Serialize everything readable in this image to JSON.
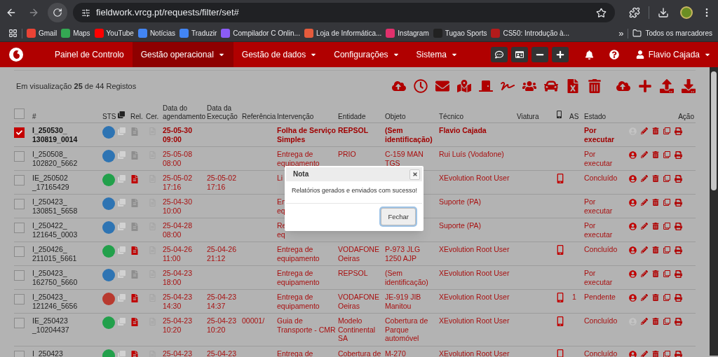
{
  "browser": {
    "url": "fieldwork.vrcg.pt/requests/filter/set#",
    "bookmarks": [
      {
        "label": "Gmail"
      },
      {
        "label": "Maps"
      },
      {
        "label": "YouTube"
      },
      {
        "label": "Notícias"
      },
      {
        "label": "Traduzir"
      },
      {
        "label": "Compilador C Onlin..."
      },
      {
        "label": "Loja de Informática..."
      },
      {
        "label": "Instagram"
      },
      {
        "label": "Tugao Sports"
      },
      {
        "label": "CS50: Introdução à..."
      }
    ],
    "more": "»",
    "all_bookmarks": "Todos os marcadores"
  },
  "navbar": {
    "menu": [
      {
        "label": "Painel de Controlo",
        "selected": false,
        "dropdown": false
      },
      {
        "label": "Gestão operacional",
        "selected": true,
        "dropdown": true
      },
      {
        "label": "Gestão de dados",
        "selected": false,
        "dropdown": true
      },
      {
        "label": "Configurações",
        "selected": false,
        "dropdown": true
      },
      {
        "label": "Sistema",
        "selected": false,
        "dropdown": true
      }
    ],
    "user": "Flavio Cajada"
  },
  "toolbar": {
    "summary": "Em visualização **25** de 44 Registos"
  },
  "table": {
    "header_checked": false,
    "columns": [
      "#",
      "STS",
      "Rel.",
      "Cer.",
      "Data do agendamento",
      "Data da Execução",
      "Referência",
      "Intervenção",
      "Entidade",
      "Objeto",
      "Técnico",
      "Viatura",
      "AS",
      "Estado",
      "Ação"
    ],
    "rows": [
      {
        "checked": true,
        "id": "I_250530_ 130819_0014",
        "color": "#2e74b3",
        "report": false,
        "scheduled": "25-05-30 09:00",
        "intervention": "Folha de Serviço Simples",
        "entity": "REPSOL",
        "object": "(Sem identificação)",
        "technician": "Flavio Cajada",
        "mobile": false,
        "state": "Por executar",
        "assigned": false
      },
      {
        "checked": false,
        "id": "I_250508_ 102820_5662",
        "color": "#2e74b3",
        "report": false,
        "scheduled": "25-05-08 08:00",
        "intervention": "Entrega de equipamento",
        "entity": "PRIO",
        "object": "C-159 MAN TGS",
        "technician": "Rui Luís (Vodafone)",
        "mobile": false,
        "state": "Por executar",
        "assigned": true
      },
      {
        "checked": false,
        "id": "IE_250502 _17165429",
        "color": "#22a04b",
        "report": true,
        "scheduled": "25-05-02 17:16",
        "executed": "25-05-02 17:16",
        "intervention": "Li",
        "technician": "XEvolution Root User",
        "mobile": true,
        "state": "Concluído",
        "assigned": true
      },
      {
        "checked": false,
        "id": "I_250423_ 130851_5658",
        "color": "#2e74b3",
        "report": false,
        "scheduled": "25-04-30 10:00",
        "intervention": "En\neq",
        "technician": "Suporte (PA)",
        "mobile": false,
        "state": "Por executar",
        "assigned": true
      },
      {
        "checked": false,
        "id": "I_250422_ 121645_0003",
        "color": "#2e74b3",
        "report": false,
        "scheduled": "25-04-28 08:00",
        "intervention": "Re\neq",
        "technician": "Suporte (PA)",
        "mobile": false,
        "state": "Por executar",
        "assigned": true
      },
      {
        "checked": false,
        "id": "I_250426_ 211015_5661",
        "color": "#22a04b",
        "report": true,
        "scheduled": "25-04-26 11:00",
        "executed": "25-04-26 21:12",
        "intervention": "Entrega de equipamento",
        "entity": "VODAFONE Oeiras",
        "object": "P-973 JLG 1250 AJP",
        "technician": "XEvolution Root User",
        "mobile": true,
        "state": "Concluído",
        "assigned": true
      },
      {
        "checked": false,
        "id": "I_250423_ 162750_5660",
        "color": "#2e74b3",
        "report": false,
        "scheduled": "25-04-23 18:00",
        "intervention": "Entrega de equipamento",
        "entity": "REPSOL",
        "object": "(Sem identificação)",
        "technician": "XEvolution Root User",
        "mobile": false,
        "state": "Por executar",
        "assigned": true
      },
      {
        "checked": false,
        "id": "I_250423_ 121246_5656",
        "color": "#b83a2f",
        "report": true,
        "scheduled": "25-04-23 14:30",
        "executed": "25-04-23 14:37",
        "intervention": "Entrega de equipamento",
        "entity": "VODAFONE Oeiras",
        "object": "JE-919 JIB Manitou",
        "technician": "XEvolution Root User",
        "mobile": true,
        "as": "1",
        "state": "Pendente",
        "assigned": true
      },
      {
        "checked": false,
        "id": "IE_250423 _10204437",
        "color": "#22a04b",
        "report": true,
        "scheduled": "25-04-23 10:20",
        "executed": "25-04-23 10:20",
        "reference": "00001/",
        "intervention": "Guia de Transporte - CMR",
        "entity": "Modelo Continental SA",
        "object": "Cobertura de Parque automóvel",
        "technician": "XEvolution Root User",
        "mobile": true,
        "state": "Concluído",
        "assigned": false
      },
      {
        "checked": false,
        "id": "I_250423_",
        "color": "#22a04b",
        "report": true,
        "scheduled": "25-04-23",
        "executed": "25-04-23",
        "intervention": "Entrega de",
        "entity": "Cobertura de",
        "object": "M-270",
        "technician": "XEvolution Root User",
        "mobile": true,
        "state": "Concluído",
        "assigned": true
      }
    ]
  },
  "modal": {
    "title": "Nota",
    "message": "Relatórios gerados e enviados com sucesso!",
    "button": "Fechar"
  }
}
